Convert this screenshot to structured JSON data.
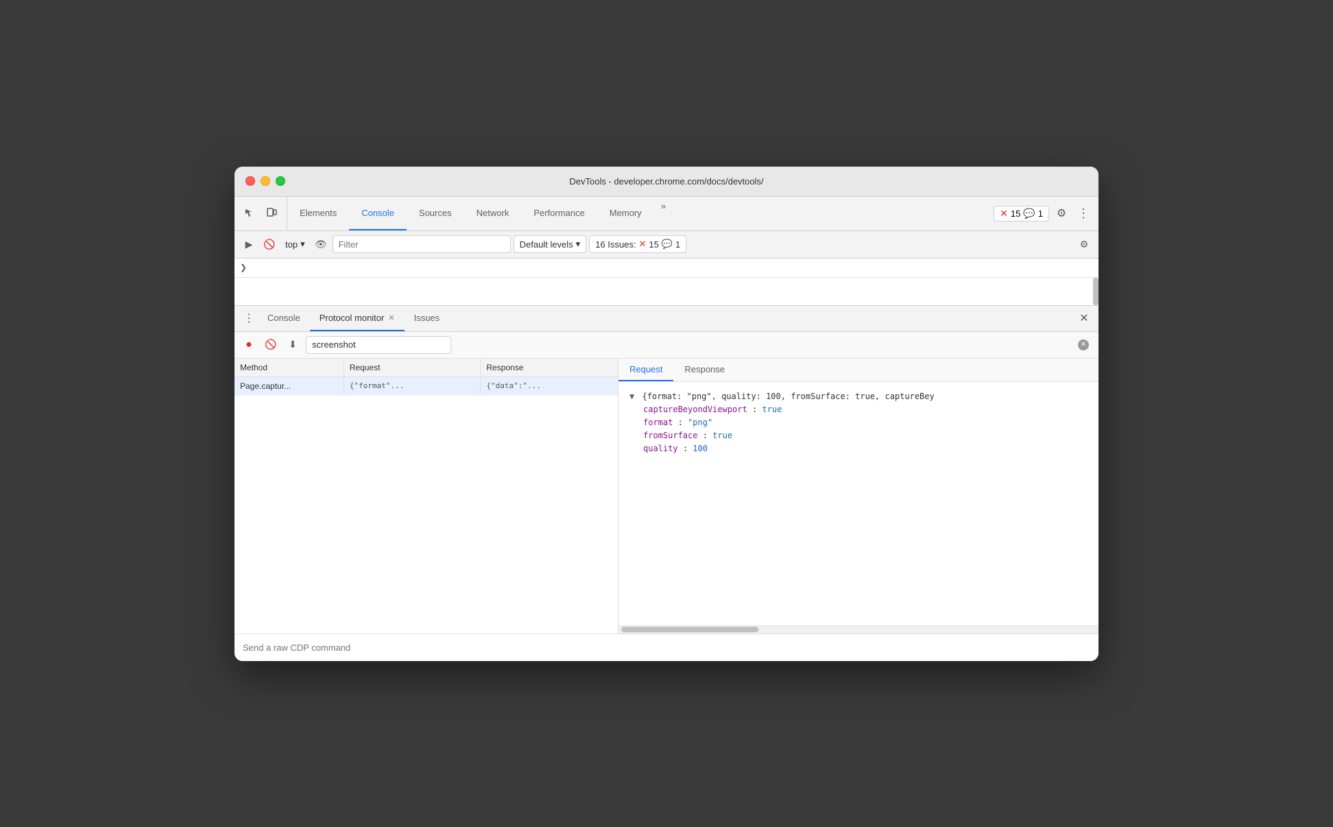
{
  "window": {
    "title": "DevTools - developer.chrome.com/docs/devtools/"
  },
  "toolbar": {
    "tabs": [
      {
        "label": "Elements",
        "active": false
      },
      {
        "label": "Console",
        "active": true
      },
      {
        "label": "Sources",
        "active": false
      },
      {
        "label": "Network",
        "active": false
      },
      {
        "label": "Performance",
        "active": false
      },
      {
        "label": "Memory",
        "active": false
      }
    ],
    "more_tabs_icon": "»",
    "error_count": "15",
    "info_count": "1",
    "settings_icon": "⚙"
  },
  "console_toolbar": {
    "top_label": "top",
    "filter_placeholder": "Filter",
    "levels_label": "Default levels",
    "issues_label": "16 Issues:",
    "issues_error": "15",
    "issues_info": "1"
  },
  "panel_tabs": [
    {
      "label": "Console",
      "active": false
    },
    {
      "label": "Protocol monitor",
      "active": true,
      "closeable": true
    },
    {
      "label": "Issues",
      "active": false
    }
  ],
  "protocol_monitor": {
    "search_value": "screenshot",
    "columns": {
      "method": "Method",
      "request": "Request",
      "response": "Response"
    },
    "rows": [
      {
        "method": "Page.captur...",
        "request": "{\"format\"...",
        "response": "{\"data\":\"..."
      }
    ],
    "detail_tabs": [
      {
        "label": "Request",
        "active": true
      },
      {
        "label": "Response",
        "active": false
      }
    ],
    "detail_object": "{format: \"png\", quality: 100, fromSurface: true, captureBey",
    "detail_fields": [
      {
        "key": "captureBeyondViewport",
        "value": "true",
        "type": "boolean"
      },
      {
        "key": "format",
        "value": "\"png\"",
        "type": "string"
      },
      {
        "key": "fromSurface",
        "value": "true",
        "type": "boolean"
      },
      {
        "key": "quality",
        "value": "100",
        "type": "number"
      }
    ]
  },
  "bottom_input": {
    "placeholder": "Send a raw CDP command"
  },
  "colors": {
    "active_tab": "#1a73e8",
    "error": "#d93025",
    "info": "#1a73e8",
    "key": "#881391",
    "string": "#1a6eae",
    "number": "#1764d1"
  }
}
